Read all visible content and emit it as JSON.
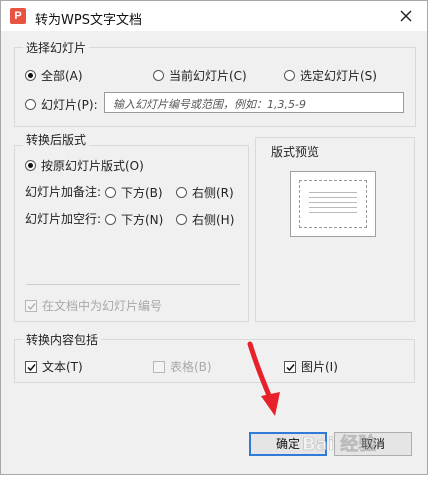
{
  "window": {
    "title": "转为WPS文字文档",
    "app_icon": "P"
  },
  "slide_range": {
    "legend": "选择幻灯片",
    "all_label": "全部(A)",
    "current_label": "当前幻灯片(C)",
    "selected_label": "选定幻灯片(S)",
    "slides_label": "幻灯片(P):",
    "range_placeholder": "输入幻灯片编号或范围，例如：1,3,5-9",
    "selected": "all"
  },
  "layout": {
    "legend": "转换后版式",
    "original_label": "按原幻灯片版式(O)",
    "notes_label": "幻灯片加备注:",
    "notes_below": "下方(B)",
    "notes_right": "右侧(R)",
    "blank_label": "幻灯片加空行:",
    "blank_below": "下方(N)",
    "blank_right": "右侧(H)",
    "number_label": "在文档中为幻灯片编号",
    "number_checked": true,
    "number_disabled": true
  },
  "preview": {
    "legend": "版式预览"
  },
  "content": {
    "legend": "转换内容包括",
    "text_label": "文本(T)",
    "text_checked": true,
    "table_label": "表格(B)",
    "table_checked": false,
    "table_disabled": true,
    "image_label": "图片(I)",
    "image_checked": true
  },
  "buttons": {
    "ok_label": "确定",
    "cancel_label": "取消"
  },
  "annotation": {
    "arrow_color": "#e8202a"
  },
  "watermark": {
    "text": "Bai 经验"
  }
}
